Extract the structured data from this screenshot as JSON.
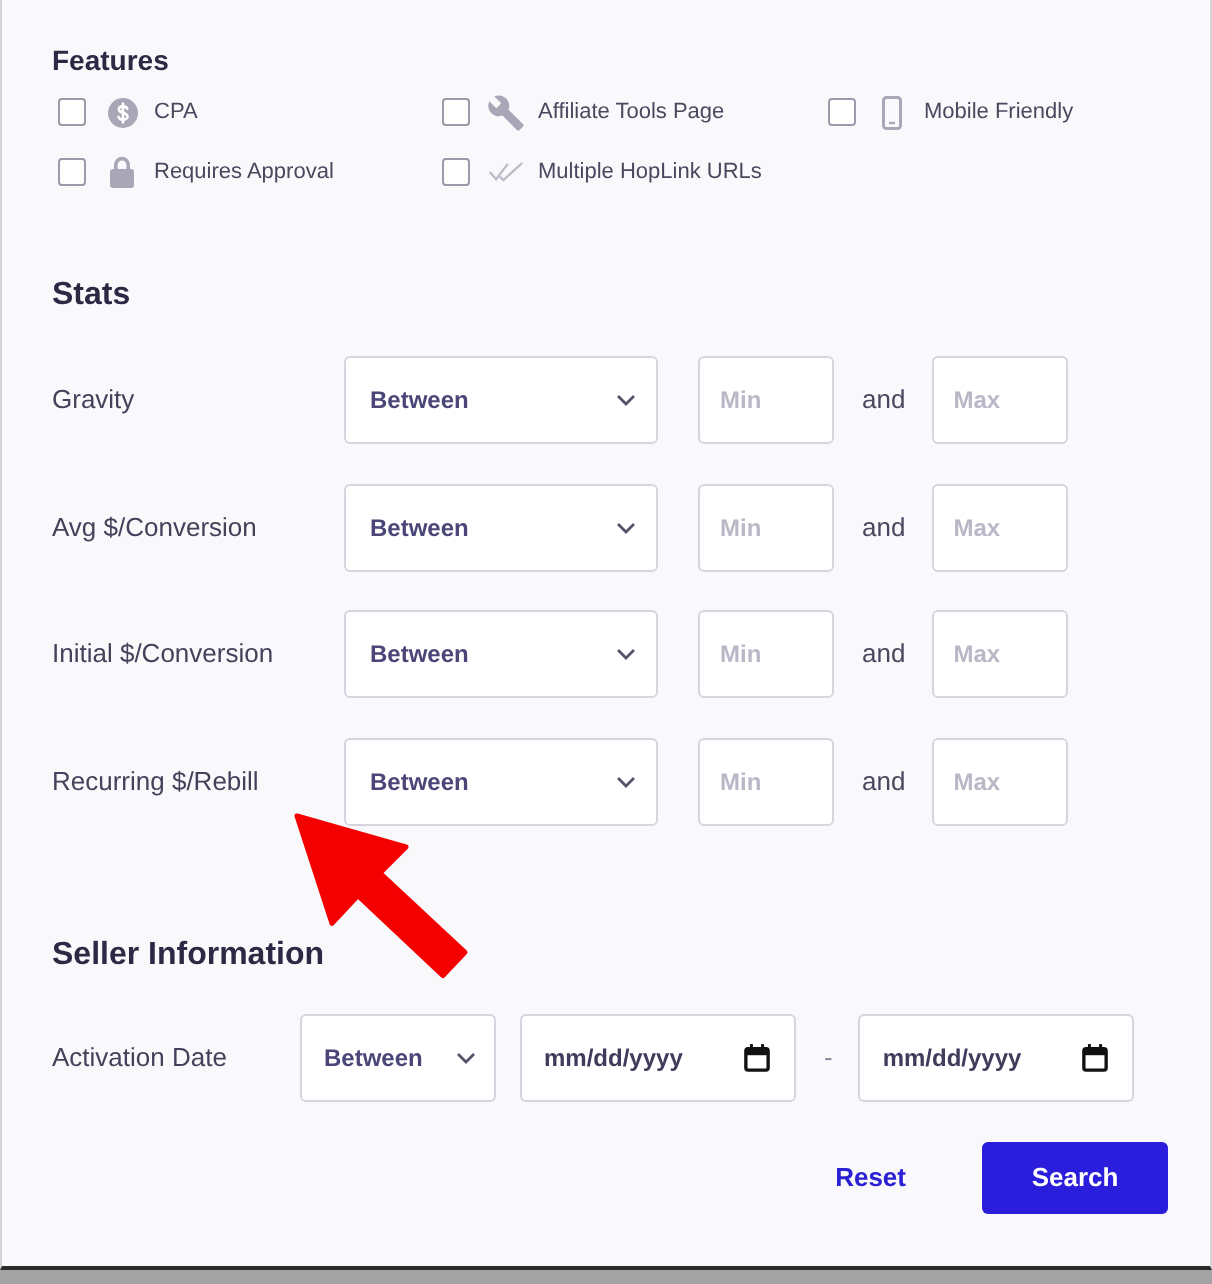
{
  "features": {
    "title": "Features",
    "options": [
      {
        "label": "CPA",
        "checked": false
      },
      {
        "label": "Affiliate Tools Page",
        "checked": false
      },
      {
        "label": "Mobile Friendly",
        "checked": false
      },
      {
        "label": "Requires Approval",
        "checked": false
      },
      {
        "label": "Multiple HopLink URLs",
        "checked": false
      }
    ]
  },
  "stats": {
    "title": "Stats",
    "rows": [
      {
        "label": "Gravity",
        "operator": "Between",
        "min": {
          "placeholder": "Min"
        },
        "connector": "and",
        "max": {
          "placeholder": "Max"
        }
      },
      {
        "label": "Avg $/Conversion",
        "operator": "Between",
        "min": {
          "placeholder": "Min"
        },
        "connector": "and",
        "max": {
          "placeholder": "Max"
        }
      },
      {
        "label": "Initial $/Conversion",
        "operator": "Between",
        "min": {
          "placeholder": "Min"
        },
        "connector": "and",
        "max": {
          "placeholder": "Max"
        }
      },
      {
        "label": "Recurring $/Rebill",
        "operator": "Between",
        "min": {
          "placeholder": "Min"
        },
        "connector": "and",
        "max": {
          "placeholder": "Max"
        }
      }
    ]
  },
  "seller_information": {
    "title": "Seller Information",
    "rows": [
      {
        "label": "Activation Date",
        "operator": "Between",
        "from": {
          "placeholder": "mm/dd/yyyy"
        },
        "separator": "-",
        "to": {
          "placeholder": "mm/dd/yyyy"
        }
      }
    ]
  },
  "actions": [
    {
      "label": "Reset",
      "kind": "link"
    },
    {
      "label": "Search",
      "kind": "primary"
    }
  ]
}
